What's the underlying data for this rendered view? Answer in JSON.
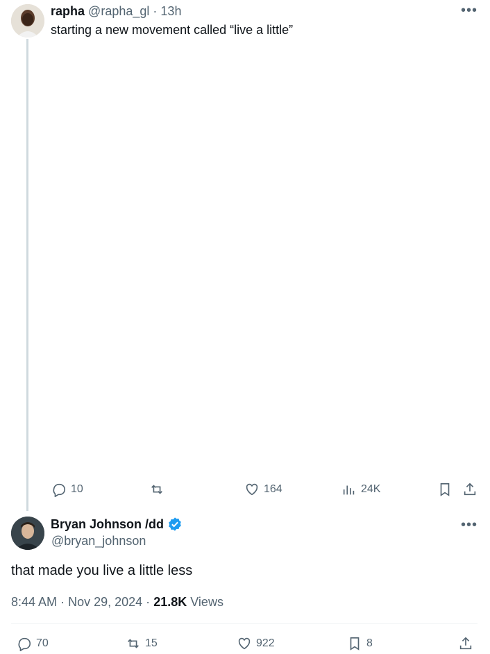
{
  "reply_tweet": {
    "author_name": "rapha",
    "handle": "@rapha_gl",
    "separator": "·",
    "time": "13h",
    "text": "starting a new movement called “live a little”",
    "actions": {
      "replies": "10",
      "likes": "164",
      "views": "24K"
    }
  },
  "main_tweet": {
    "author_name": "Bryan Johnson /dd",
    "handle": "@bryan_johnson",
    "text": "that made you live a little less",
    "time": "8:44 AM",
    "separator": "·",
    "date": "Nov 29, 2024",
    "views_count": "21.8K",
    "views_label": "Views",
    "actions": {
      "replies": "70",
      "retweets": "15",
      "likes": "922",
      "bookmarks": "8"
    }
  },
  "colors": {
    "verified": "#1d9bf0",
    "muted": "#536471",
    "line": "#cfd9de"
  }
}
